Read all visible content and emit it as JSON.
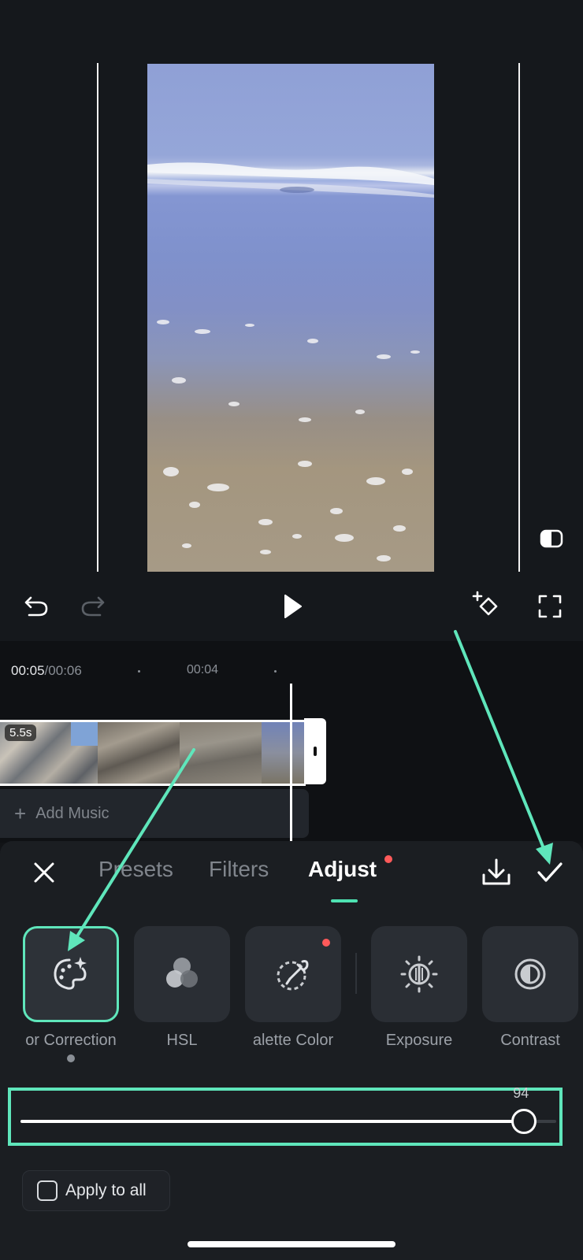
{
  "preview": {
    "compare_icon": "split-compare-icon"
  },
  "controls": {
    "undo_icon": "undo-icon",
    "redo_icon": "redo-icon",
    "play_icon": "play-icon",
    "keyframe_icon": "add-keyframe-icon",
    "fullscreen_icon": "fullscreen-icon"
  },
  "timeline": {
    "current_time": "00:05",
    "separator": "/",
    "total_time": "00:06",
    "marker_time": "00:04",
    "clip_duration": "5.5s",
    "add_music_label": "Add Music",
    "add_music_plus": "+"
  },
  "panel": {
    "tabs": [
      {
        "label": "Presets",
        "active": false
      },
      {
        "label": "Filters",
        "active": false
      },
      {
        "label": "Adjust",
        "active": true
      }
    ],
    "tools": [
      {
        "label": "or Correction",
        "icon": "palette-sparkle-icon",
        "selected": true
      },
      {
        "label": "HSL",
        "icon": "hsl-circles-icon",
        "selected": false
      },
      {
        "label": "alette   Color",
        "icon": "eyedropper-icon",
        "selected": false
      },
      {
        "label": "Exposure",
        "icon": "exposure-icon",
        "selected": false
      },
      {
        "label": "Contrast",
        "icon": "contrast-icon",
        "selected": false
      }
    ],
    "slider": {
      "value": 94,
      "value_label": "94",
      "max": 100
    },
    "apply_to_all": {
      "label": "Apply to all",
      "checked": false
    }
  },
  "colors": {
    "accent": "#5fe6bb",
    "notification": "#ff5a5a",
    "background": "#121417",
    "panel": "#1b1e22"
  }
}
